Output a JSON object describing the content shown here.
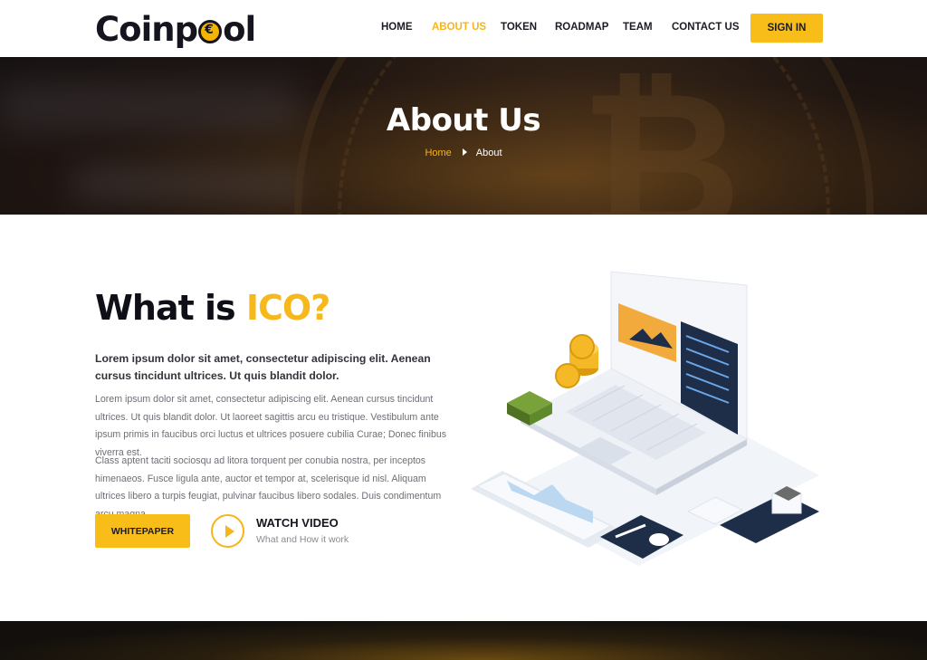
{
  "brand": {
    "name_part1": "Coinp",
    "name_part2": "ol"
  },
  "nav": {
    "items": [
      {
        "label": "HOME",
        "active": false
      },
      {
        "label": "ABOUT US",
        "active": true
      },
      {
        "label": "TOKEN",
        "active": false
      },
      {
        "label": "ROADMAP",
        "active": false
      },
      {
        "label": "TEAM",
        "active": false
      },
      {
        "label": "CONTACT US",
        "active": false
      }
    ],
    "signin_label": "SIGN IN"
  },
  "banner": {
    "title": "About Us",
    "breadcrumb": {
      "home": "Home",
      "current": "About"
    }
  },
  "about": {
    "heading_main": "What is ",
    "heading_accent": "ICO?",
    "lead": "Lorem ipsum dolor sit amet, consectetur adipiscing elit. Aenean cursus tincidunt ultrices. Ut quis blandit dolor.",
    "paragraph1": "Lorem ipsum dolor sit amet, consectetur adipiscing elit. Aenean cursus tincidunt ultrices. Ut quis blandit dolor. Ut laoreet sagittis arcu eu tristique. Vestibulum ante ipsum primis in faucibus orci luctus et ultrices posuere cubilia Curae; Donec finibus viverra est.",
    "paragraph2": "Class aptent taciti sociosqu ad litora torquent per conubia nostra, per inceptos himenaeos. Fusce ligula ante, auctor et tempor at, scelerisque id nisl. Aliquam ultrices libero a turpis feugiat, pulvinar faucibus libero sodales. Duis condimentum arcu magna.",
    "whitepaper_label": "WHITEPAPER",
    "watch_title": "WATCH VIDEO",
    "watch_subtitle": "What and How it work"
  },
  "colors": {
    "accent": "#f9bd1a",
    "dark": "#15151f",
    "text_muted": "#6e6e76"
  }
}
